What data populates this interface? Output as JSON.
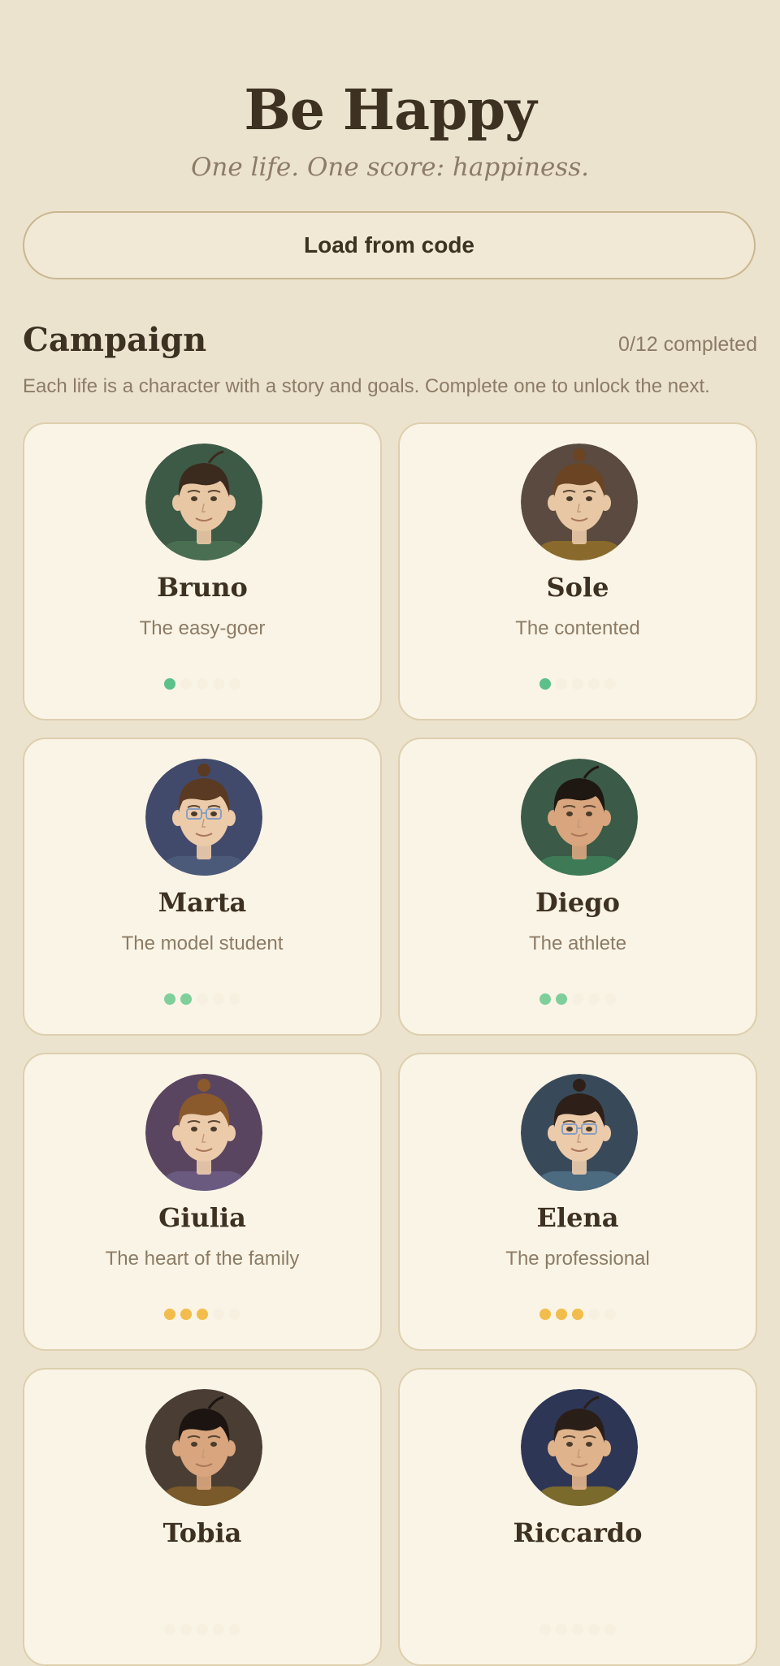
{
  "header": {
    "title": "Be Happy",
    "tagline": "One life. One score: happiness."
  },
  "load_button": {
    "label": "Load from code"
  },
  "campaign": {
    "title": "Campaign",
    "progress": "0/12 completed",
    "description": "Each life is a character with a story and goals. Complete one to unlock the next."
  },
  "characters": [
    {
      "name": "Bruno",
      "role": "The easy-goer",
      "difficulty": 1,
      "max_difficulty": 5,
      "dot_color": "#5bc08a",
      "bg_color": "#3d5a47",
      "hair_color": "#3b2a1e",
      "shirt_color": "#4a6e52",
      "skin_color": "#e8c7a5",
      "bun": false,
      "glasses": false
    },
    {
      "name": "Sole",
      "role": "The contented",
      "difficulty": 1,
      "max_difficulty": 5,
      "dot_color": "#5bc08a",
      "bg_color": "#5a4a3f",
      "hair_color": "#6b4423",
      "shirt_color": "#8a6a2c",
      "skin_color": "#e8c7a5",
      "bun": true,
      "glasses": false
    },
    {
      "name": "Marta",
      "role": "The model student",
      "difficulty": 2,
      "max_difficulty": 5,
      "dot_color": "#7fcf9c",
      "bg_color": "#424a6b",
      "hair_color": "#5a3a22",
      "shirt_color": "#4c5a7a",
      "skin_color": "#eccbab",
      "bun": true,
      "glasses": true
    },
    {
      "name": "Diego",
      "role": "The athlete",
      "difficulty": 2,
      "max_difficulty": 5,
      "dot_color": "#7fcf9c",
      "bg_color": "#3b5a48",
      "hair_color": "#1e1712",
      "shirt_color": "#3f7a56",
      "skin_color": "#d8a57e",
      "bun": false,
      "glasses": false
    },
    {
      "name": "Giulia",
      "role": "The heart of the family",
      "difficulty": 3,
      "max_difficulty": 5,
      "dot_color": "#f2bd4c",
      "bg_color": "#5a4560",
      "hair_color": "#8a5a2c",
      "shirt_color": "#6a5a80",
      "skin_color": "#eccbab",
      "bun": true,
      "glasses": false
    },
    {
      "name": "Elena",
      "role": "The professional",
      "difficulty": 3,
      "max_difficulty": 5,
      "dot_color": "#f2bd4c",
      "bg_color": "#384a5a",
      "hair_color": "#2e2018",
      "shirt_color": "#4c6a80",
      "skin_color": "#eccbab",
      "bun": true,
      "glasses": true
    },
    {
      "name": "Tobia",
      "role": "",
      "difficulty": 0,
      "max_difficulty": 5,
      "dot_color": "#f2bd4c",
      "bg_color": "#4a3e34",
      "hair_color": "#1c1410",
      "shirt_color": "#7a5a2a",
      "skin_color": "#d8a57e",
      "bun": false,
      "glasses": false
    },
    {
      "name": "Riccardo",
      "role": "",
      "difficulty": 0,
      "max_difficulty": 5,
      "dot_color": "#f2bd4c",
      "bg_color": "#2e3656",
      "hair_color": "#2a1f18",
      "shirt_color": "#7a6a2c",
      "skin_color": "#dfb38c",
      "bun": false,
      "glasses": false
    }
  ]
}
